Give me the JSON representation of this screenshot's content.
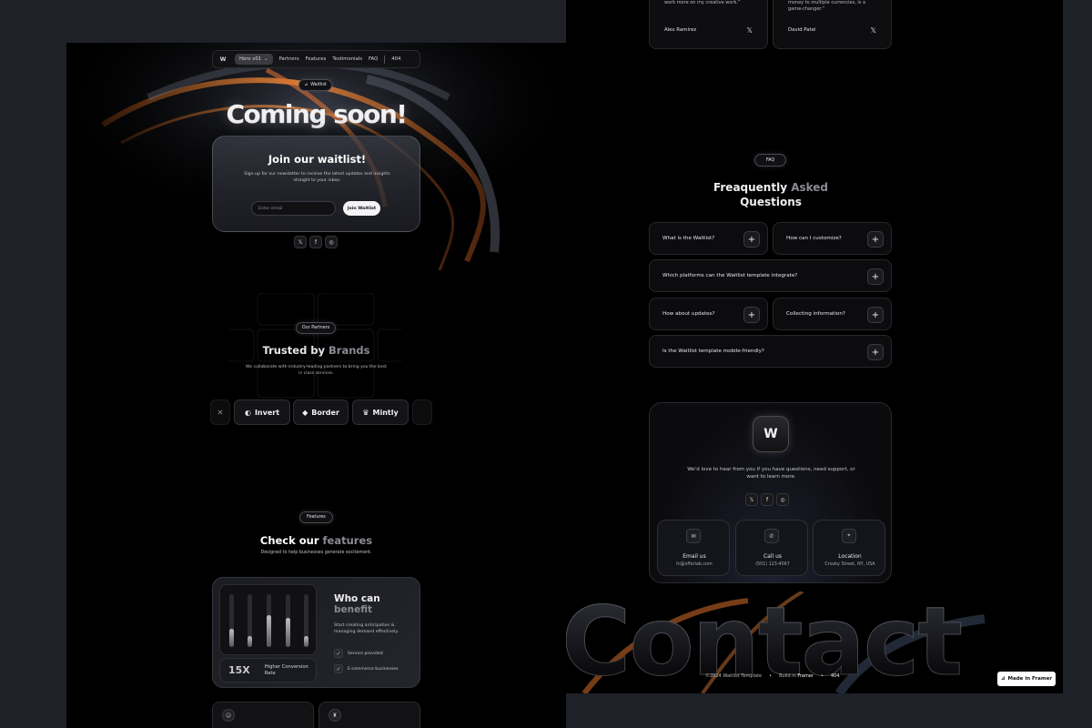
{
  "nav": {
    "logo": "W",
    "hero": "Hero v01",
    "links": [
      "Partners",
      "Features",
      "Testimonials",
      "FAQ"
    ],
    "extra": "404"
  },
  "hero": {
    "badge": "Waitlist",
    "title": "Coming soon!",
    "card_title": "Join our waitlist!",
    "card_desc": "Sign up for our newsletter to receive the latest updates and insights straight to your inbox.",
    "email_placeholder": "Enter email",
    "join_label": "Join Waitlist"
  },
  "socials": {
    "icons": [
      "x-icon",
      "facebook-icon",
      "instagram-icon"
    ],
    "glyphs": [
      "𝕏",
      "f",
      "◎"
    ]
  },
  "partners": {
    "badge": "Our Partners",
    "title_main": "Trusted by ",
    "title_dim": "Brands",
    "desc": "We collaborate with industry-leading partners to bring you the best in class services.",
    "brands": [
      "Invert",
      "Border",
      "Mintly"
    ]
  },
  "features": {
    "badge": "Features",
    "title_main": "Check our ",
    "title_dim": "features",
    "desc": "Designed to help businesses generate excitement."
  },
  "benefit": {
    "title_main": "Who can ",
    "title_dim": "benefit",
    "desc": "Start creating anticipation & managing demand effectively.",
    "stat_value": "15X",
    "stat_label": "Higher Conversion Rate",
    "checks": [
      "Service provided",
      "E-commerce businesses"
    ],
    "bar_levels": [
      0.35,
      0.2,
      0.6,
      0.55,
      0.2
    ]
  },
  "testimonials": [
    {
      "quote": "work more on my creative work.”",
      "author": "Alex Ramirez"
    },
    {
      "quote": "money to multiple currencies, is a game-changer.”",
      "author": "David Patel"
    }
  ],
  "faq": {
    "badge": "FAQ",
    "title_main": "Freaquently ",
    "title_dim": "Asked",
    "title_line2": "Questions",
    "questions": [
      "What is the Waitlist?",
      "How can I customize?",
      "Which platforms can the Waitlist template integrate?",
      "How about updates?",
      "Collecting information?",
      "Is the Waitlist template mobile-friendly?"
    ]
  },
  "contact": {
    "logo": "W",
    "desc": "We'd love to hear from you if you have questions, need support, or want to learn more.",
    "boxes": [
      {
        "label": "Email us",
        "value": "hi@offerlab.com",
        "icon": "mail-icon",
        "glyph": "✉"
      },
      {
        "label": "Call us",
        "value": "(501) 123-4567",
        "icon": "phone-icon",
        "glyph": "✆"
      },
      {
        "label": "Location",
        "value": "Crosby Street, NY, USA",
        "icon": "location-pin-icon",
        "glyph": "⌖"
      }
    ],
    "big_word": "Contact"
  },
  "footer": {
    "copyright": "©2024 Waitlist Template",
    "built_prefix": "Build in",
    "built_brand": "Framer",
    "link": "404",
    "made_in": "Made in Framer"
  },
  "colors": {
    "accent_orange": "#e07a2c",
    "background": "#000000",
    "canvas": "#1e2128"
  }
}
